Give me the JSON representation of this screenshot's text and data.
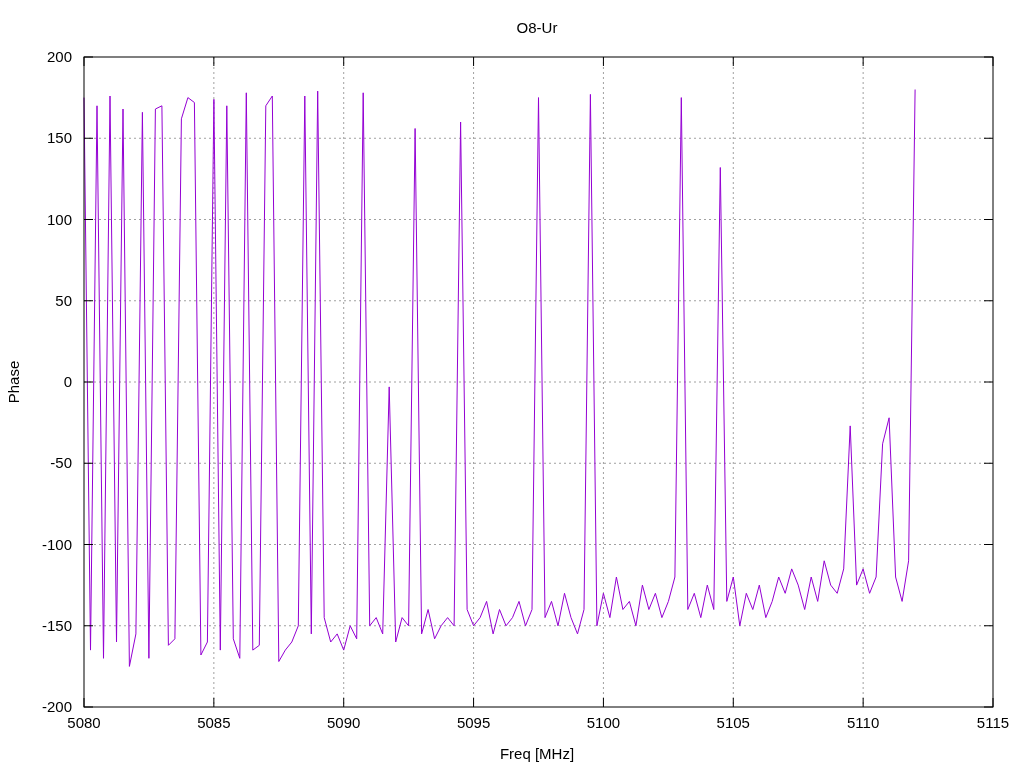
{
  "chart_data": {
    "type": "line",
    "title": "O8-Ur",
    "xlabel": "Freq [MHz]",
    "ylabel": "Phase",
    "xlim": [
      5080,
      5115
    ],
    "ylim": [
      -200,
      200
    ],
    "grid": true,
    "xticks": [
      5080,
      5085,
      5090,
      5095,
      5100,
      5105,
      5110,
      5115
    ],
    "yticks": [
      -200,
      -150,
      -100,
      -50,
      0,
      50,
      100,
      150,
      200
    ],
    "x": [
      5080,
      5080.25,
      5080.5,
      5080.75,
      5081,
      5081.25,
      5081.5,
      5081.75,
      5082,
      5082.25,
      5082.5,
      5082.75,
      5083,
      5083.25,
      5083.5,
      5083.75,
      5084,
      5084.25,
      5084.5,
      5084.75,
      5085,
      5085.25,
      5085.5,
      5085.75,
      5086,
      5086.25,
      5086.5,
      5086.75,
      5087,
      5087.25,
      5087.5,
      5087.75,
      5088,
      5088.25,
      5088.5,
      5088.75,
      5089,
      5089.25,
      5089.5,
      5089.75,
      5090,
      5090.25,
      5090.5,
      5090.75,
      5091,
      5091.25,
      5091.5,
      5091.75,
      5092,
      5092.25,
      5092.5,
      5092.75,
      5093,
      5093.25,
      5093.5,
      5093.75,
      5094,
      5094.25,
      5094.5,
      5094.75,
      5095,
      5095.25,
      5095.5,
      5095.75,
      5096,
      5096.25,
      5096.5,
      5096.75,
      5097,
      5097.25,
      5097.5,
      5097.75,
      5098,
      5098.25,
      5098.5,
      5098.75,
      5099,
      5099.25,
      5099.5,
      5099.75,
      5100,
      5100.25,
      5100.5,
      5100.75,
      5101,
      5101.25,
      5101.5,
      5101.75,
      5102,
      5102.25,
      5102.5,
      5102.75,
      5103,
      5103.25,
      5103.5,
      5103.75,
      5104,
      5104.25,
      5104.5,
      5104.75,
      5105,
      5105.25,
      5105.5,
      5105.75,
      5106,
      5106.25,
      5106.5,
      5106.75,
      5107,
      5107.25,
      5107.5,
      5107.75,
      5108,
      5108.25,
      5108.5,
      5108.75,
      5109,
      5109.25,
      5109.5,
      5109.75,
      5110,
      5110.25,
      5110.5,
      5110.75,
      5111,
      5111.25,
      5111.5,
      5111.75,
      5112
    ],
    "series": [
      {
        "color": "#9400d3",
        "values": [
          175,
          -165,
          170,
          -170,
          176,
          -160,
          168,
          -175,
          -155,
          166,
          -170,
          168,
          170,
          -162,
          -158,
          162,
          175,
          172,
          -168,
          -160,
          174,
          -165,
          170,
          -158,
          -170,
          178,
          -165,
          -162,
          170,
          176,
          -172,
          -165,
          -160,
          -150,
          176,
          -155,
          179,
          -145,
          -160,
          -155,
          -165,
          -150,
          -158,
          178,
          -150,
          -145,
          -155,
          -3,
          -160,
          -145,
          -150,
          156,
          -155,
          -140,
          -158,
          -150,
          -145,
          -150,
          160,
          -140,
          -150,
          -145,
          -135,
          -155,
          -140,
          -150,
          -145,
          -135,
          -150,
          -140,
          175,
          -145,
          -135,
          -150,
          -130,
          -145,
          -155,
          -140,
          177,
          -150,
          -130,
          -145,
          -120,
          -140,
          -135,
          -150,
          -125,
          -140,
          -130,
          -145,
          -135,
          -120,
          175,
          -140,
          -130,
          -145,
          -125,
          -140,
          132,
          -135,
          -120,
          -150,
          -130,
          -140,
          -125,
          -145,
          -135,
          -120,
          -130,
          -115,
          -125,
          -140,
          -120,
          -135,
          -110,
          -125,
          -130,
          -115,
          -27,
          -125,
          -115,
          -130,
          -120,
          -38,
          -22,
          -120,
          -135,
          -110,
          180
        ]
      }
    ]
  }
}
